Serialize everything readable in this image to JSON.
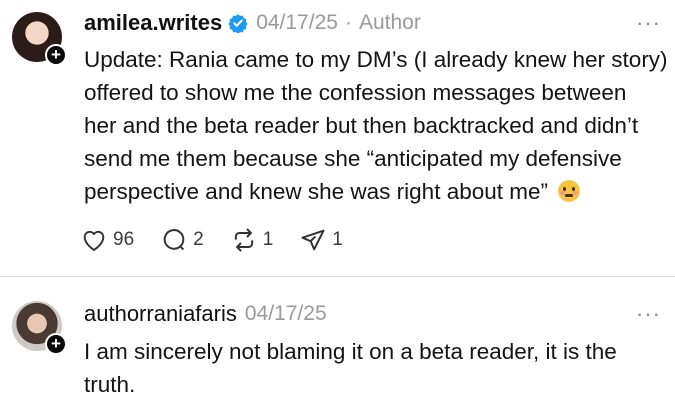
{
  "posts": [
    {
      "username": "amilea.writes",
      "verified": true,
      "date": "04/17/25",
      "separator": "·",
      "tag": "Author",
      "more": "···",
      "follow_symbol": "+",
      "lines": [
        "Update: Rania came to my DM’s (I already knew her story)",
        "offered to show me the confession messages between",
        "her and the beta reader but then backtracked and didn’t",
        "send me them because she “anticipated my defensive",
        "perspective and knew she was right about me”"
      ],
      "emoji": "flushed-face",
      "actions": {
        "likes": "96",
        "replies": "2",
        "reposts": "1",
        "shares": "1"
      }
    },
    {
      "username": "authorraniafaris",
      "date": "04/17/25",
      "more": "···",
      "follow_symbol": "+",
      "lines": [
        "I am sincerely not blaming it on a beta reader, it is the",
        "truth."
      ]
    }
  ],
  "colors": {
    "verified": "#1d9bf0",
    "meta": "#9a9a9a",
    "divider": "#dadada"
  }
}
